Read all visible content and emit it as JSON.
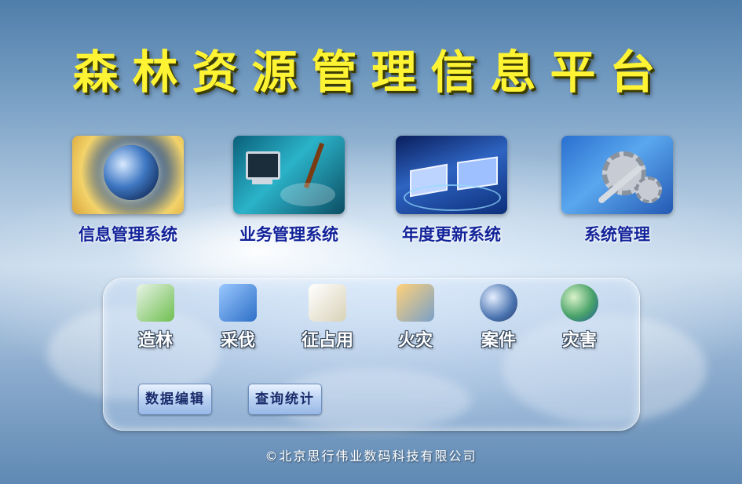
{
  "title": "森林资源管理信息平台",
  "modules": [
    {
      "label": "信息管理系统",
      "icon": "globe-icon"
    },
    {
      "label": "业务管理系统",
      "icon": "business-computer-icon"
    },
    {
      "label": "年度更新系统",
      "icon": "laptop-network-icon"
    },
    {
      "label": "系统管理",
      "icon": "gear-wrench-icon"
    }
  ],
  "tools": [
    {
      "label": "造林",
      "icon": "leaf-pen-icon"
    },
    {
      "label": "采伐",
      "icon": "hammer-map-icon"
    },
    {
      "label": "征占用",
      "icon": "document-pen-icon"
    },
    {
      "label": "火灾",
      "icon": "fire-magnifier-icon"
    },
    {
      "label": "案件",
      "icon": "globe-pen-icon"
    },
    {
      "label": "灾害",
      "icon": "globe-leaf-icon"
    }
  ],
  "buttons": {
    "data_edit": "数据编辑",
    "query_stats": "查询统计"
  },
  "footer": "©北京思行伟业数码科技有限公司",
  "colors": {
    "title": "#fff433",
    "module_label": "#12239a",
    "tool_label": "#ffffff"
  }
}
